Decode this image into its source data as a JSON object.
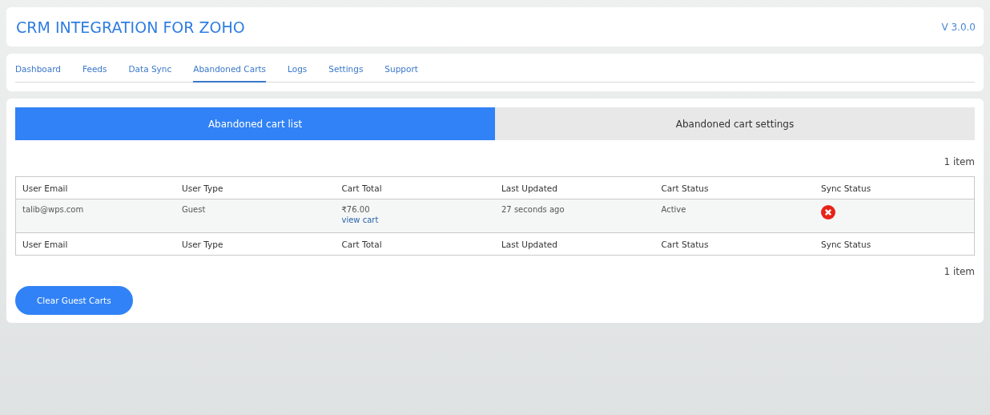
{
  "header": {
    "title": "CRM INTEGRATION FOR ZOHO",
    "version": "V 3.0.0"
  },
  "nav": [
    {
      "label": "Dashboard",
      "selected": false
    },
    {
      "label": "Feeds",
      "selected": false
    },
    {
      "label": "Data Sync",
      "selected": false
    },
    {
      "label": "Abandoned Carts",
      "selected": true
    },
    {
      "label": "Logs",
      "selected": false
    },
    {
      "label": "Settings",
      "selected": false
    },
    {
      "label": "Support",
      "selected": false
    }
  ],
  "subtabs": [
    {
      "label": "Abandoned cart list",
      "selected": true
    },
    {
      "label": "Abandoned cart settings",
      "selected": false
    }
  ],
  "count_top": "1 item",
  "table": {
    "columns": [
      "User Email",
      "User Type",
      "Cart Total",
      "Last Updated",
      "Cart Status",
      "Sync Status"
    ],
    "rows": [
      {
        "email": "talib@wps.com",
        "user_type": "Guest",
        "cart_total": "₹76.00",
        "cart_link": "view cart",
        "last_updated": "27 seconds ago",
        "cart_status": "Active",
        "synced": false
      }
    ],
    "footer_columns": [
      "User Email",
      "User Type",
      "Cart Total",
      "Last Updated",
      "Cart Status",
      "Sync Status"
    ]
  },
  "count_bottom": "1 item",
  "clear_button": "Clear Guest Carts"
}
